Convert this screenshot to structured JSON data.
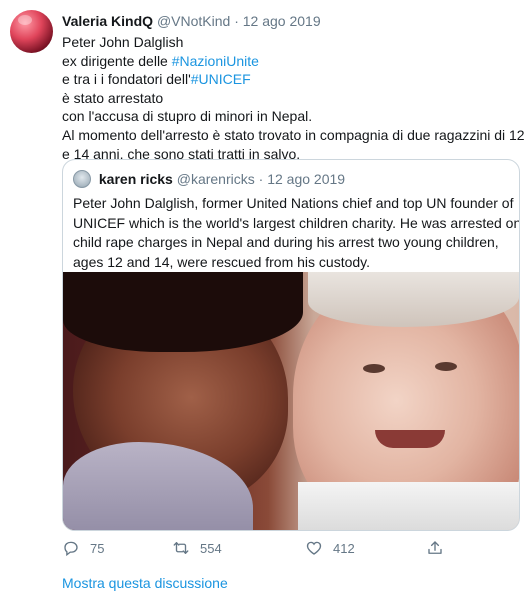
{
  "tweet": {
    "author": {
      "name": "Valeria KindQ",
      "handle": "@VNotKind",
      "separator": "·",
      "date": "12 ago 2019"
    },
    "lines": [
      {
        "text": "Peter John Dalglish"
      },
      {
        "prefix": "ex dirigente delle ",
        "link": "#NazioniUnite"
      },
      {
        "prefix": "e tra i i fondatori dell'",
        "link": "#UNICEF"
      },
      {
        "text": "è stato arrestato"
      },
      {
        "text": "con l'accusa di stupro di minori in Nepal."
      },
      {
        "text": "Al momento dell'arresto è stato trovato in compagnia di due ragazzini di 12"
      },
      {
        "text": "e 14 anni, che sono stati tratti in salvo."
      }
    ],
    "quoted": {
      "name": "karen ricks",
      "handle": "@karenricks",
      "separator": "·",
      "date": "12 ago 2019",
      "lines": [
        "Peter John Dalglish, former United Nations chief and top UN founder of",
        "UNICEF which is the world's largest children charity. He was arrested on",
        "child rape charges in Nepal and during his arrest two young children,",
        "ages 12 and 14, were rescued from his custody."
      ]
    },
    "actions": {
      "replies": "75",
      "retweets": "554",
      "likes": "412"
    },
    "more_link": "Mostra questa discussione"
  },
  "icons": {
    "reply": "reply-icon",
    "retweet": "retweet-icon",
    "like": "heart-icon",
    "share": "share-icon"
  },
  "colors": {
    "link": "#1b95e0",
    "muted": "#657786",
    "text": "#14171a",
    "border": "#ccd6dd"
  }
}
